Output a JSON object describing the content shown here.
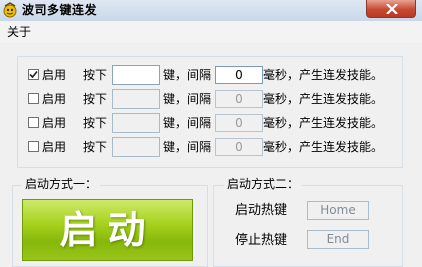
{
  "window": {
    "title": "波司多键连发",
    "close_icon": "close-icon"
  },
  "menu": [
    {
      "label": "关于"
    }
  ],
  "rows": [
    {
      "checked": true,
      "enable_label": "启用",
      "press_label": "按下",
      "key_value": "",
      "key_interval_label": "键，间隔",
      "interval": "0",
      "suffix": "毫秒，产生连发技能。"
    },
    {
      "checked": false,
      "enable_label": "启用",
      "press_label": "按下",
      "key_value": "",
      "key_interval_label": "键，间隔",
      "interval": "0",
      "suffix": "毫秒，产生连发技能。"
    },
    {
      "checked": false,
      "enable_label": "启用",
      "press_label": "按下",
      "key_value": "",
      "key_interval_label": "键，间隔",
      "interval": "0",
      "suffix": "毫秒，产生连发技能。"
    },
    {
      "checked": false,
      "enable_label": "启用",
      "press_label": "按下",
      "key_value": "",
      "key_interval_label": "键，间隔",
      "interval": "0",
      "suffix": "毫秒，产生连发技能。"
    }
  ],
  "mode1": {
    "title": "启动方式一：",
    "button_label": "启动",
    "button_color": "#a6d21d"
  },
  "mode2": {
    "title": "启动方式二：",
    "start_hotkey_label": "启动热键",
    "start_hotkey_value": "Home",
    "stop_hotkey_label": "停止热键",
    "stop_hotkey_value": "End"
  }
}
